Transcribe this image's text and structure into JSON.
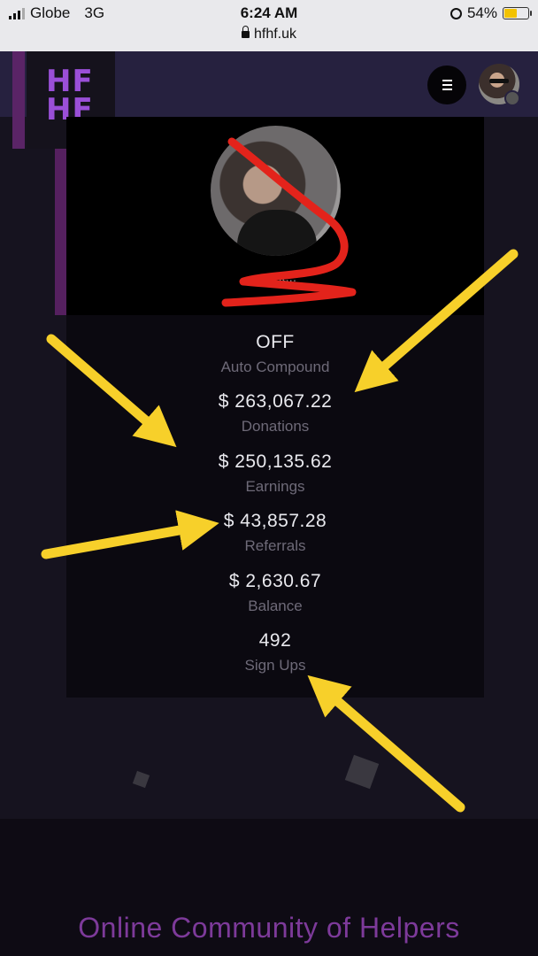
{
  "status_bar": {
    "carrier": "Globe",
    "network": "3G",
    "time": "6:24 AM",
    "battery_percent": "54%",
    "battery_level": 0.54,
    "url": "hfhf.uk"
  },
  "header": {
    "logo_line1": "HF",
    "logo_line2": "HF",
    "logo_color": "#9a4fd8",
    "header_color": "#26213f"
  },
  "profile": {
    "name": "cvnt..."
  },
  "stats": [
    {
      "value": "OFF",
      "label": "Auto Compound"
    },
    {
      "value": "$ 263,067.22",
      "label": "Donations"
    },
    {
      "value": "$ 250,135.62",
      "label": "Earnings"
    },
    {
      "value": "$ 43,857.28",
      "label": "Referrals"
    },
    {
      "value": "$ 2,630.67",
      "label": "Balance"
    },
    {
      "value": "492",
      "label": "Sign Ups"
    }
  ],
  "footer": {
    "tagline": "Online Community of Helpers",
    "tagline_color": "#7d3a9a"
  },
  "annotations": {
    "arrow_color": "#f7d02a",
    "scribble_color": "#e3231b"
  }
}
